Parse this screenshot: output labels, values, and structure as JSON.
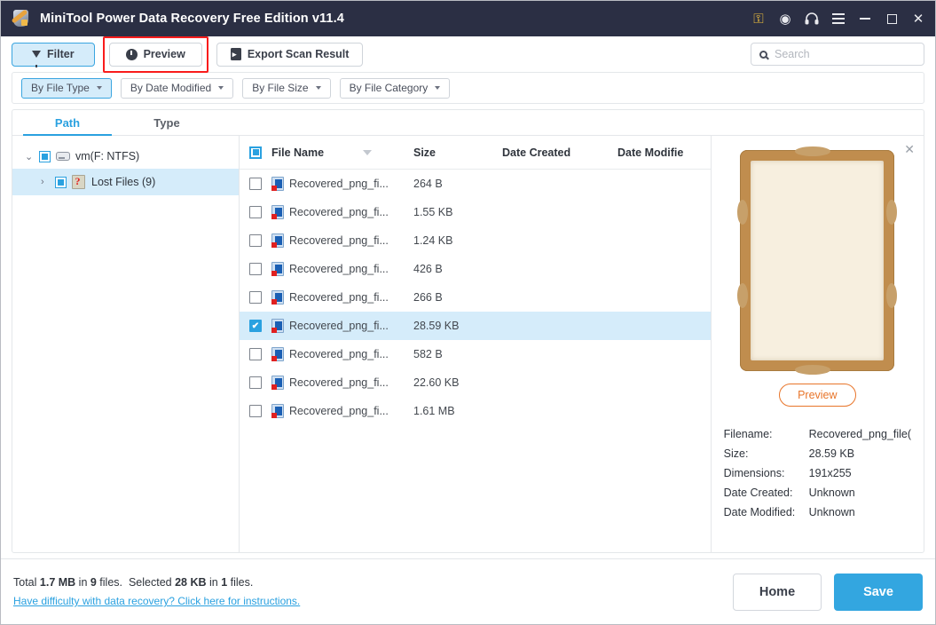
{
  "titlebar": {
    "app_title": "MiniTool Power Data Recovery Free Edition v11.4",
    "logo_icon": "minitool-logo-icon",
    "icons": [
      {
        "name": "key-icon",
        "glyph": "⚷"
      },
      {
        "name": "disc-icon",
        "glyph": "◉"
      },
      {
        "name": "headphones-icon",
        "glyph": "Ω"
      }
    ],
    "menu_icon": "hamburger-menu-icon",
    "minimize_icon": "minimize-icon",
    "maximize_icon": "maximize-icon",
    "close_icon": "close-icon",
    "close_glyph": "✕",
    "bg_color": "#2b2f44"
  },
  "toolbar": {
    "filter_label": "Filter",
    "filter_icon": "funnel-icon",
    "preview_label": "Preview",
    "preview_icon": "eye-icon",
    "export_label": "Export Scan Result",
    "export_icon": "export-icon",
    "highlight_color": "#f91c1c",
    "active_bg": "#d5ecfa"
  },
  "search": {
    "icon": "search-icon",
    "placeholder": "Search",
    "value": ""
  },
  "filterbar": {
    "buttons": [
      {
        "label": "By File Type",
        "active": true
      },
      {
        "label": "By Date Modified",
        "active": false
      },
      {
        "label": "By File Size",
        "active": false
      },
      {
        "label": "By File Category",
        "active": false
      }
    ]
  },
  "tabs": [
    {
      "label": "Path",
      "active": true
    },
    {
      "label": "Type",
      "active": false
    }
  ],
  "tree": {
    "root": {
      "label": "vm(F: NTFS)",
      "twist": "⌄",
      "drive_icon": "drive-icon",
      "checkbox": "partial"
    },
    "child": {
      "label": "Lost Files (9)",
      "twist": "›",
      "folder_icon": "lost-files-icon",
      "checkbox": "partial",
      "selected": true
    }
  },
  "filelist": {
    "columns": [
      "File Name",
      "Size",
      "Date Created",
      "Date Modifie"
    ],
    "header_checkbox": "partial",
    "sort_icon": "sort-descending-icon",
    "rows": [
      {
        "name": "Recovered_png_fi...",
        "size": "264 B",
        "date_created": "",
        "date_modified": "",
        "checked": false
      },
      {
        "name": "Recovered_png_fi...",
        "size": "1.55 KB",
        "date_created": "",
        "date_modified": "",
        "checked": false
      },
      {
        "name": "Recovered_png_fi...",
        "size": "1.24 KB",
        "date_created": "",
        "date_modified": "",
        "checked": false
      },
      {
        "name": "Recovered_png_fi...",
        "size": "426 B",
        "date_created": "",
        "date_modified": "",
        "checked": false
      },
      {
        "name": "Recovered_png_fi...",
        "size": "266 B",
        "date_created": "",
        "date_modified": "",
        "checked": false
      },
      {
        "name": "Recovered_png_fi...",
        "size": "28.59 KB",
        "date_created": "",
        "date_modified": "",
        "checked": true
      },
      {
        "name": "Recovered_png_fi...",
        "size": "582 B",
        "date_created": "",
        "date_modified": "",
        "checked": false
      },
      {
        "name": "Recovered_png_fi...",
        "size": "22.60 KB",
        "date_created": "",
        "date_modified": "",
        "checked": false
      },
      {
        "name": "Recovered_png_fi...",
        "size": "1.61 MB",
        "date_created": "",
        "date_modified": "",
        "checked": false
      }
    ]
  },
  "preview_panel": {
    "close_icon": "close-preview-icon",
    "close_glyph": "✕",
    "thumbnail_name": "parchment-certificate-thumbnail",
    "preview_button_label": "Preview",
    "accent_color": "#e8752a",
    "metadata": [
      {
        "key": "Filename:",
        "value": "Recovered_png_file("
      },
      {
        "key": "Size:",
        "value": "28.59 KB"
      },
      {
        "key": "Dimensions:",
        "value": "191x255"
      },
      {
        "key": "Date Created:",
        "value": "Unknown"
      },
      {
        "key": "Date Modified:",
        "value": "Unknown"
      }
    ]
  },
  "footer": {
    "total_prefix": "Total ",
    "total_size": "1.7 MB",
    "total_mid": " in ",
    "total_count": "9",
    "total_suffix": " files.",
    "selected_prefix": "Selected ",
    "selected_size": "28 KB",
    "selected_mid": " in ",
    "selected_count": "1",
    "selected_suffix": " files.",
    "help_link": "Have difficulty with data recovery? Click here for instructions.",
    "home_label": "Home",
    "save_label": "Save",
    "save_color": "#33a6e0"
  }
}
